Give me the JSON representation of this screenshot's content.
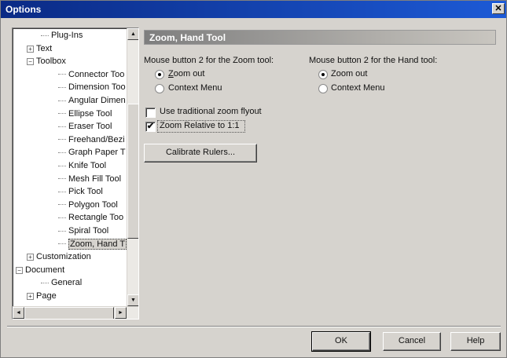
{
  "window": {
    "title": "Options",
    "close_label": "✕"
  },
  "tree": {
    "items": [
      {
        "label": "Plug-Ins",
        "expander": "",
        "depth": 2
      },
      {
        "label": "Text",
        "expander": "+",
        "depth": 1
      },
      {
        "label": "Toolbox",
        "expander": "−",
        "depth": 1
      },
      {
        "label": "Connector Too",
        "expander": "",
        "depth": 3
      },
      {
        "label": "Dimension Too",
        "expander": "",
        "depth": 3
      },
      {
        "label": "Angular Dimen",
        "expander": "",
        "depth": 3
      },
      {
        "label": "Ellipse Tool",
        "expander": "",
        "depth": 3
      },
      {
        "label": "Eraser Tool",
        "expander": "",
        "depth": 3
      },
      {
        "label": "Freehand/Bezi",
        "expander": "",
        "depth": 3
      },
      {
        "label": "Graph Paper T",
        "expander": "",
        "depth": 3
      },
      {
        "label": "Knife Tool",
        "expander": "",
        "depth": 3
      },
      {
        "label": "Mesh Fill Tool",
        "expander": "",
        "depth": 3
      },
      {
        "label": "Pick Tool",
        "expander": "",
        "depth": 3
      },
      {
        "label": "Polygon Tool",
        "expander": "",
        "depth": 3
      },
      {
        "label": "Rectangle Too",
        "expander": "",
        "depth": 3
      },
      {
        "label": "Spiral Tool",
        "expander": "",
        "depth": 3
      },
      {
        "label": "Zoom, Hand T",
        "expander": "",
        "depth": 3,
        "selected": true
      },
      {
        "label": "Customization",
        "expander": "+",
        "depth": 1
      },
      {
        "label": "Document",
        "expander": "−",
        "depth": 0
      },
      {
        "label": "General",
        "expander": "",
        "depth": 2
      },
      {
        "label": "Page",
        "expander": "+",
        "depth": 1
      }
    ],
    "scroll_up": "▲",
    "scroll_down": "▼",
    "scroll_left": "◄",
    "scroll_right": "►"
  },
  "panel": {
    "header": "Zoom, Hand Tool",
    "zoom_group_label": "Mouse button 2 for the Zoom tool:",
    "hand_group_label": "Mouse button 2 for the Hand tool:",
    "zoom_options": [
      "Zoom out",
      "Context Menu"
    ],
    "zoom_selected": 0,
    "hand_options": [
      "Zoom out",
      "Context Menu"
    ],
    "hand_selected": 0,
    "check_traditional": {
      "label": "Use traditional zoom flyout",
      "checked": false
    },
    "check_relative": {
      "label": "Zoom Relative to 1:1",
      "checked": true
    },
    "calibrate_button": "Calibrate Rulers..."
  },
  "footer": {
    "ok": "OK",
    "cancel": "Cancel",
    "help": "Help"
  },
  "check_mark": "✔"
}
